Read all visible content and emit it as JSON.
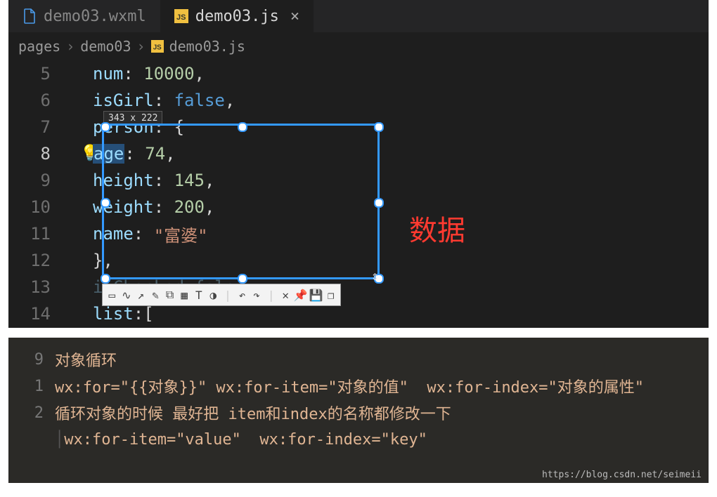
{
  "tabs": {
    "tab0": {
      "label": "demo03.wxml"
    },
    "tab1": {
      "label": "demo03.js",
      "close": "×"
    }
  },
  "breadcrumb": {
    "p0": "pages",
    "p1": "demo03",
    "p2": "demo03.js",
    "sep": "›"
  },
  "lines": {
    "n5": "5",
    "n6": "6",
    "n7": "7",
    "n8": "8",
    "n9": "9",
    "n10": "10",
    "n11": "11",
    "n12": "12",
    "n13": "13",
    "n14": "14"
  },
  "code": {
    "l5": {
      "k": "num",
      "c": ": ",
      "v": "10000",
      "t": ","
    },
    "l6": {
      "k": "isGirl",
      "c": ": ",
      "v": "false",
      "t": ","
    },
    "l7": {
      "k": "person",
      "c": ": ",
      "b": "{"
    },
    "l8": {
      "k": "age",
      "c": ": ",
      "v": "74",
      "t": ","
    },
    "l9": {
      "k": "height",
      "c": ": ",
      "v": "145",
      "t": ","
    },
    "l10": {
      "k": "weight",
      "c": ": ",
      "v": "200",
      "t": ","
    },
    "l11": {
      "k": "name",
      "c": ": ",
      "v": "\"富婆\""
    },
    "l12": {
      "b": "}",
      "t": ","
    },
    "l13": {
      "raw": "isChecked:false"
    },
    "l14": {
      "k": "list",
      "c": ":",
      "b": "["
    }
  },
  "selection": {
    "dim": "343 x 222"
  },
  "annotation": {
    "label": "数据"
  },
  "bottom": {
    "n9": "9",
    "t9": "对象循环",
    "n1": "1",
    "t1": "wx:for=\"{{对象}}\" wx:for-item=\"对象的值\"  wx:for-index=\"对象的属性\"",
    "n2": "2",
    "t2": "循环对象的时候 最好把 item和index的名称都修改一下",
    "t3": "wx:for-item=\"value\"  wx:for-index=\"key\""
  },
  "watermark": "https://blog.csdn.net/seimeii"
}
